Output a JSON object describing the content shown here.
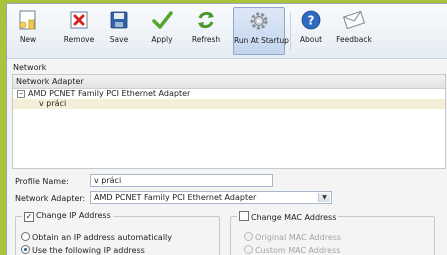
{
  "toolbar": {
    "buttons": [
      {
        "label": "New",
        "icon": "new-document-icon"
      },
      {
        "label": "Remove",
        "icon": "remove-x-icon"
      },
      {
        "label": "Save",
        "icon": "floppy-disk-icon"
      },
      {
        "label": "Apply",
        "icon": "checkmark-icon"
      },
      {
        "label": "Refresh",
        "icon": "refresh-arrows-icon"
      },
      {
        "label": "Run At Startup",
        "icon": "gear-icon"
      },
      {
        "label": "About",
        "icon": "question-icon"
      },
      {
        "label": "Feedback",
        "icon": "envelope-icon"
      }
    ],
    "active": "Run At Startup"
  },
  "network": {
    "section_label": "Network",
    "list_header": "Network Adapter",
    "adapter_name": "AMD PCNET Family PCI Ethernet Adapter",
    "profile_item": "v práci",
    "expand_glyph": "−"
  },
  "form": {
    "profile_name_label": "Profile Name:",
    "profile_name_value": "v práci",
    "network_adapter_label": "Network Adapter:",
    "network_adapter_value": "AMD PCNET Family PCI Ethernet Adapter",
    "dropdown_arrow": "▼"
  },
  "ip_group": {
    "title": "Change IP Address",
    "checked": true,
    "check_mark": "✓",
    "option_auto": "Obtain an IP address automatically",
    "option_manual": "Use the following IP address",
    "selected": "manual"
  },
  "mac_group": {
    "title": "Change MAC Address",
    "checked": false,
    "option_original": "Original MAC Address",
    "option_custom": "Custom MAC Address",
    "enabled": false
  },
  "colors": {
    "background_green": "#a9c33a",
    "accent_blue": "#2b5ea0",
    "selection": "#f3efd9"
  }
}
